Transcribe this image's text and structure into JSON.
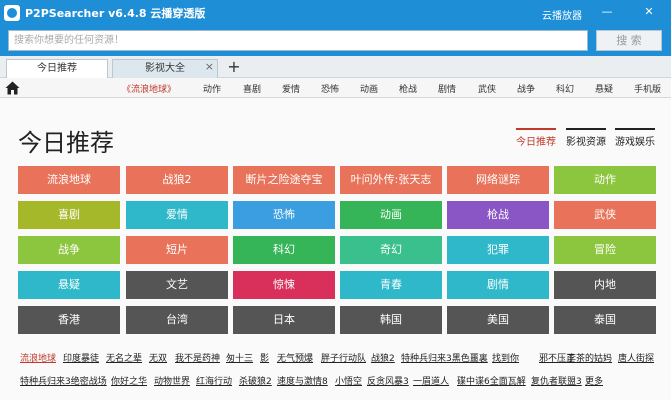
{
  "window": {
    "title": "P2PSearcher v6.4.8 云播穿透版",
    "cloud_label": "云播放器",
    "minimize_glyph": "—",
    "close_glyph": "✕"
  },
  "search": {
    "placeholder": "搜索你想要的任何资源！",
    "button_label": "搜 索"
  },
  "tabs": [
    {
      "label": "今日推荐",
      "active": true
    },
    {
      "label": "影视大全",
      "active": false
    }
  ],
  "tab_close_glyph": "×",
  "tab_new_glyph": "+",
  "catnav": {
    "items": [
      "《流浪地球》",
      "动作",
      "喜剧",
      "爱情",
      "恐怖",
      "动画",
      "枪战",
      "剧情",
      "武侠",
      "战争",
      "科幻",
      "悬疑",
      "手机版"
    ]
  },
  "main": {
    "title": "今日推荐",
    "right_tabs": [
      "今日推荐",
      "影视资源",
      "游戏娱乐"
    ],
    "grid": [
      [
        "流浪地球",
        "战狼2",
        "断片之险途夺宝",
        "叶问外传:张天志",
        "网络谜踪",
        "动作"
      ],
      [
        "喜剧",
        "爱情",
        "恐怖",
        "动画",
        "枪战",
        "武侠"
      ],
      [
        "战争",
        "短片",
        "科幻",
        "奇幻",
        "犯罪",
        "冒险"
      ],
      [
        "悬疑",
        "文艺",
        "惊悚",
        "青春",
        "剧情",
        "内地"
      ],
      [
        "香港",
        "台湾",
        "日本",
        "韩国",
        "美国",
        "泰国"
      ]
    ],
    "grid_colors": [
      [
        "#e8735a",
        "#e8735a",
        "#e8735a",
        "#e8735a",
        "#e8735a",
        "#8cc63f"
      ],
      [
        "#a4b82a",
        "#2fb8c9",
        "#3a9ee0",
        "#35b458",
        "#8a55c4",
        "#e8735a"
      ],
      [
        "#8cc63f",
        "#e8735a",
        "#35b458",
        "#3ac08c",
        "#2fb8c9",
        "#8cc63f"
      ],
      [
        "#2fb8c9",
        "#555555",
        "#d8305a",
        "#2fb8c9",
        "#2fb8c9",
        "#555555"
      ],
      [
        "#555555",
        "#555555",
        "#555555",
        "#555555",
        "#555555",
        "#555555"
      ]
    ],
    "links_row1": [
      "流浪地球",
      "印度暴徒",
      "无名之辈",
      "无双",
      "我不是药神",
      "匆十三",
      "影",
      "无气预爆",
      "胖子行动队",
      "战狼2",
      "特种兵归来3黑色噩裏",
      "找到你",
      "邪不压正",
      "李茶的姑妈",
      "唐人街探"
    ],
    "links_row2": [
      "特种兵归来3绝密战场",
      "你好之华",
      "动物世界",
      "红海行动",
      "杀破狼2",
      "速度与激情8",
      "小悟空",
      "反贪风暴3",
      "一眉道人",
      "碟中谍6全面瓦解",
      "复仇者联盟3",
      "更多"
    ]
  }
}
